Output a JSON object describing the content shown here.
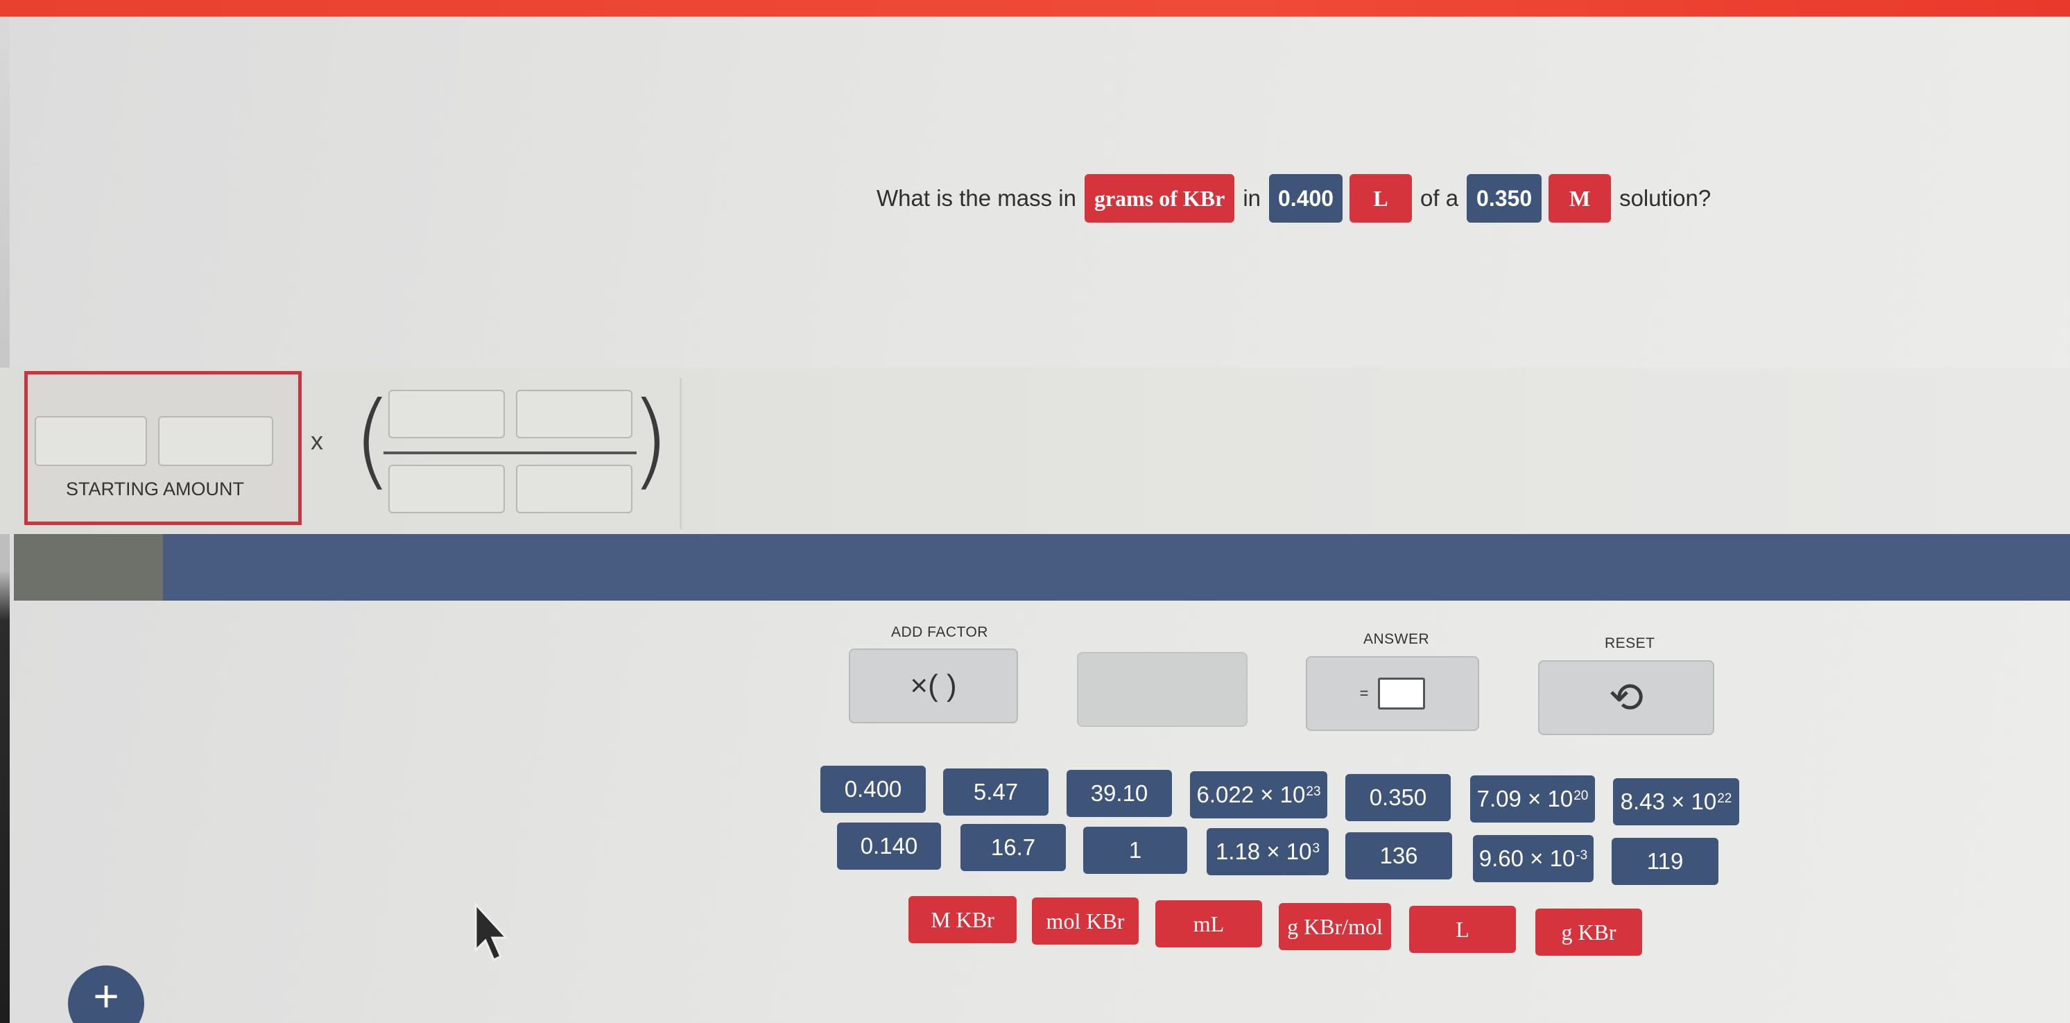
{
  "question": {
    "prefix": "What is the mass in",
    "target_unit": "grams of KBr",
    "in_text": "in",
    "volume_value": "0.400",
    "volume_unit": "L",
    "of_a_text": "of a",
    "molarity_value": "0.350",
    "molarity_unit": "M",
    "suffix": "solution?"
  },
  "workspace": {
    "starting_amount_label": "STARTING AMOUNT",
    "times_sign": "x"
  },
  "controls": {
    "add_factor_label": "ADD FACTOR",
    "add_factor_glyph": "×( )",
    "answer_label": "ANSWER",
    "answer_glyph": "=",
    "reset_label": "RESET",
    "reset_glyph": "⟲"
  },
  "number_tiles": {
    "row1": [
      "0.400",
      "5.47",
      "39.10",
      "6.022 × 10",
      "0.350",
      "7.09 × 10",
      "8.43 × 10"
    ],
    "row1_exp": [
      "",
      "",
      "",
      "23",
      "",
      "20",
      "22"
    ],
    "row2": [
      "0.140",
      "16.7",
      "1",
      "1.18 × 10",
      "136",
      "9.60 × 10",
      "119"
    ],
    "row2_exp": [
      "",
      "",
      "",
      "3",
      "",
      "-3",
      ""
    ]
  },
  "unit_tiles": [
    "M KBr",
    "mol KBr",
    "mL",
    "g KBr/mol",
    "L",
    "g KBr"
  ],
  "fab_label": "+",
  "colors": {
    "red_accent": "#d5343c",
    "blue_tile": "#3e5478",
    "band_blue": "#485c82",
    "top_bar": "#ee4433"
  }
}
